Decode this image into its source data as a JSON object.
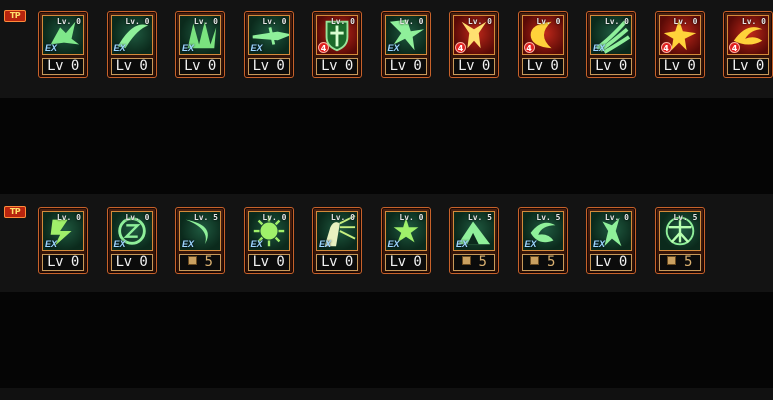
{
  "rows": [
    {
      "tag": "TP",
      "skills": [
        {
          "icon": "clawed-beast-icon",
          "tint": "green",
          "level_tag": "Lv. 0",
          "mark": "EX",
          "level": "Lv 0"
        },
        {
          "icon": "sweeping-slash-icon",
          "tint": "green",
          "level_tag": "Lv. 0",
          "mark": "EX",
          "level": "Lv 0"
        },
        {
          "icon": "spiral-burst-icon",
          "tint": "green",
          "level_tag": "Lv. 0",
          "mark": "EX",
          "level": "Lv 0"
        },
        {
          "icon": "flying-dagger-icon",
          "tint": "green",
          "level_tag": "Lv. 0",
          "mark": "EX",
          "level": "Lv 0"
        },
        {
          "icon": "shield-emblem-icon",
          "tint": "red",
          "level_tag": "Lv. 0",
          "mark": "4",
          "level": "Lv 0"
        },
        {
          "icon": "shatter-blast-icon",
          "tint": "green",
          "level_tag": "Lv. 0",
          "mark": "EX",
          "level": "Lv 0"
        },
        {
          "icon": "horned-demon-icon",
          "tint": "red",
          "level_tag": "Lv. 0",
          "mark": "4",
          "level": "Lv 0"
        },
        {
          "icon": "crescent-moon-icon",
          "tint": "red",
          "level_tag": "Lv. 0",
          "mark": "4",
          "level": "Lv 0"
        },
        {
          "icon": "wind-blades-icon",
          "tint": "green",
          "level_tag": "Lv. 0",
          "mark": "EX",
          "level": "Lv 0"
        },
        {
          "icon": "cross-strike-icon",
          "tint": "red",
          "level_tag": "Lv. 0",
          "mark": "4",
          "level": "Lv 0"
        },
        {
          "icon": "whirlwind-icon",
          "tint": "red",
          "level_tag": "Lv. 0",
          "mark": "4",
          "level": "Lv 0"
        }
      ]
    },
    {
      "tag": "TP",
      "skills": [
        {
          "icon": "lightning-fist-icon",
          "tint": "green",
          "level_tag": "Lv. 0",
          "mark": "EX",
          "level": "Lv 0"
        },
        {
          "icon": "rune-circle-icon",
          "tint": "green",
          "level_tag": "Lv. 0",
          "mark": "EX",
          "level": "Lv 0"
        },
        {
          "icon": "arc-slash-icon",
          "tint": "green",
          "level_tag": "Lv. 5",
          "mark": "EX",
          "level": "5",
          "points": true
        },
        {
          "icon": "sun-face-icon",
          "tint": "green",
          "level_tag": "Lv. 0",
          "mark": "EX",
          "level": "Lv 0"
        },
        {
          "icon": "radiant-figure-icon",
          "tint": "green",
          "level_tag": "Lv. 0",
          "mark": "EX",
          "level": "Lv 0"
        },
        {
          "icon": "star-burst-icon",
          "tint": "green",
          "level_tag": "Lv. 0",
          "mark": "EX",
          "level": "Lv 0"
        },
        {
          "icon": "rising-peak-icon",
          "tint": "green",
          "level_tag": "Lv. 5",
          "mark": "EX",
          "level": "5",
          "points": true
        },
        {
          "icon": "comet-spiral-icon",
          "tint": "green",
          "level_tag": "Lv. 5",
          "mark": "EX",
          "level": "5",
          "points": true
        },
        {
          "icon": "spirit-warrior-icon",
          "tint": "green",
          "level_tag": "Lv. 0",
          "mark": "EX",
          "level": "Lv 0"
        },
        {
          "icon": "vitruvian-figure-icon",
          "tint": "green",
          "level_tag": "Lv. 5",
          "mark": "",
          "level": "5",
          "points": true
        }
      ]
    }
  ]
}
